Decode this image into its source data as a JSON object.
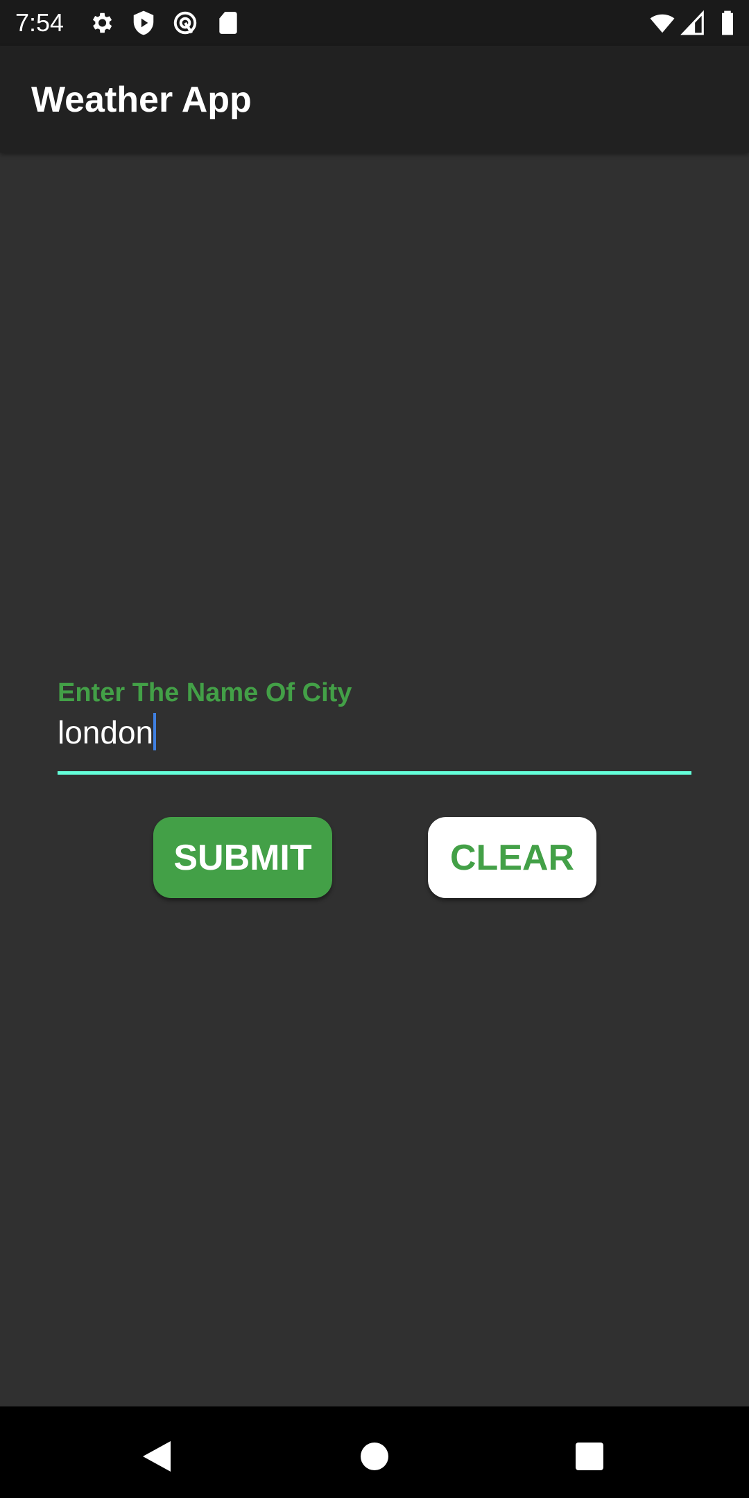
{
  "status_bar": {
    "time": "7:54",
    "icons": [
      "settings-icon",
      "shield-play-icon",
      "vpn-icon",
      "sd-card-icon",
      "wifi-icon",
      "signal-icon",
      "battery-icon"
    ]
  },
  "app_bar": {
    "title": "Weather App"
  },
  "form": {
    "label": "Enter The Name Of City",
    "value": "london",
    "accent": "#43a047",
    "underline_color": "#64ffda"
  },
  "buttons": {
    "submit": "SUBMIT",
    "clear": "CLEAR"
  },
  "nav_bar": {
    "icons": [
      "back-icon",
      "home-icon",
      "recents-icon"
    ]
  }
}
